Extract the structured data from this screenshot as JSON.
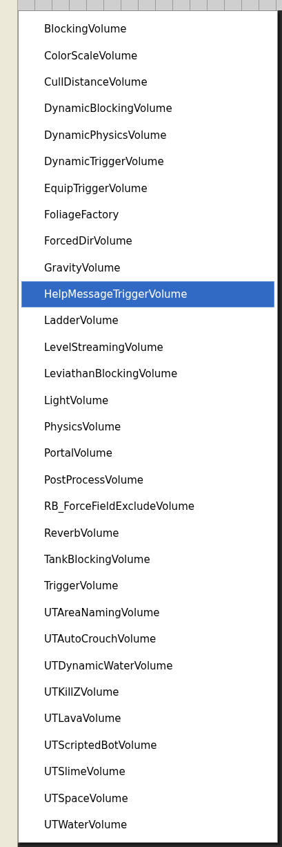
{
  "menu": {
    "items": [
      {
        "label": "BlockingVolume",
        "selected": false
      },
      {
        "label": "ColorScaleVolume",
        "selected": false
      },
      {
        "label": "CullDistanceVolume",
        "selected": false
      },
      {
        "label": "DynamicBlockingVolume",
        "selected": false
      },
      {
        "label": "DynamicPhysicsVolume",
        "selected": false
      },
      {
        "label": "DynamicTriggerVolume",
        "selected": false
      },
      {
        "label": "EquipTriggerVolume",
        "selected": false
      },
      {
        "label": "FoliageFactory",
        "selected": false
      },
      {
        "label": "ForcedDirVolume",
        "selected": false
      },
      {
        "label": "GravityVolume",
        "selected": false
      },
      {
        "label": "HelpMessageTriggerVolume",
        "selected": true
      },
      {
        "label": "LadderVolume",
        "selected": false
      },
      {
        "label": "LevelStreamingVolume",
        "selected": false
      },
      {
        "label": "LeviathanBlockingVolume",
        "selected": false
      },
      {
        "label": "LightVolume",
        "selected": false
      },
      {
        "label": "PhysicsVolume",
        "selected": false
      },
      {
        "label": "PortalVolume",
        "selected": false
      },
      {
        "label": "PostProcessVolume",
        "selected": false
      },
      {
        "label": "RB_ForceFieldExcludeVolume",
        "selected": false
      },
      {
        "label": "ReverbVolume",
        "selected": false
      },
      {
        "label": "TankBlockingVolume",
        "selected": false
      },
      {
        "label": "TriggerVolume",
        "selected": false
      },
      {
        "label": "UTAreaNamingVolume",
        "selected": false
      },
      {
        "label": "UTAutoCrouchVolume",
        "selected": false
      },
      {
        "label": "UTDynamicWaterVolume",
        "selected": false
      },
      {
        "label": "UTKillZVolume",
        "selected": false
      },
      {
        "label": "UTLavaVolume",
        "selected": false
      },
      {
        "label": "UTScriptedBotVolume",
        "selected": false
      },
      {
        "label": "UTSlimeVolume",
        "selected": false
      },
      {
        "label": "UTSpaceVolume",
        "selected": false
      },
      {
        "label": "UTWaterVolume",
        "selected": false
      }
    ]
  }
}
